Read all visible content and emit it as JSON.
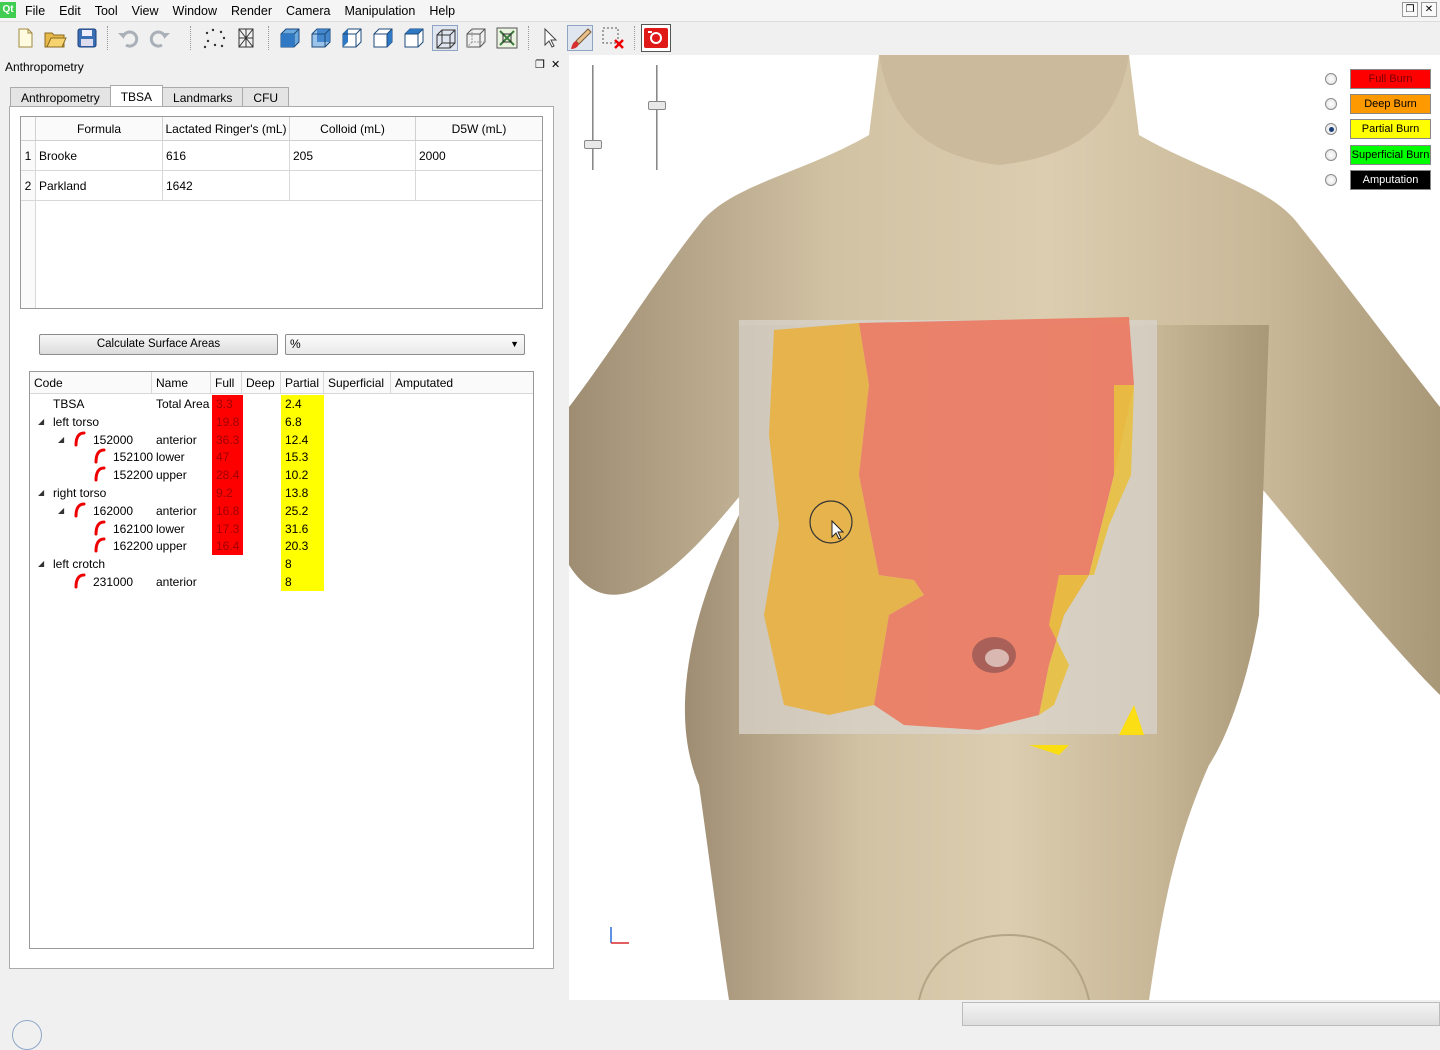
{
  "menubar": {
    "items": [
      "File",
      "Edit",
      "Tool",
      "View",
      "Window",
      "Render",
      "Camera",
      "Manipulation",
      "Help"
    ],
    "logo": "Qt"
  },
  "toolbar": {
    "icons": [
      "new-file-icon",
      "open-folder-icon",
      "save-icon",
      "undo-icon",
      "redo-icon",
      "point-cloud-icon",
      "mesh-icon",
      "cube-front-icon",
      "cube-back-icon",
      "cube-left-icon",
      "cube-right-icon",
      "cube-top-icon",
      "cube-wireframe-icon",
      "cube-transparent-icon",
      "fit-view-icon",
      "pointer-icon",
      "paint-brush-icon",
      "delete-selection-icon",
      "camera-snapshot-icon"
    ]
  },
  "dock": {
    "title": "Anthropometry",
    "tabs": [
      "Anthropometry",
      "TBSA",
      "Landmarks",
      "CFU"
    ],
    "active_tab": "TBSA"
  },
  "formula_table": {
    "headers": [
      "Formula",
      "Lactated Ringer's (mL)",
      "Colloid (mL)",
      "D5W (mL)"
    ],
    "rows": [
      {
        "n": "1",
        "formula": "Brooke",
        "lr": "616",
        "colloid": "205",
        "d5w": "2000"
      },
      {
        "n": "2",
        "formula": "Parkland",
        "lr": "1642",
        "colloid": "",
        "d5w": ""
      }
    ]
  },
  "controls": {
    "calc_button": "Calculate Surface Areas",
    "unit_value": "%"
  },
  "tree": {
    "headers": [
      "Code",
      "Name",
      "Full",
      "Deep",
      "Partial",
      "Superficial",
      "Amputated"
    ],
    "rows": [
      {
        "code": "TBSA",
        "name": "Total Area",
        "full": "3.3",
        "partial": "2.4"
      },
      {
        "code": "left torso",
        "name": "",
        "full": "19.8",
        "partial": "6.8"
      },
      {
        "code": "152000",
        "name": "anterior",
        "full": "36.3",
        "partial": "12.4"
      },
      {
        "code": "152100",
        "name": "lower",
        "full": "47",
        "partial": "15.3"
      },
      {
        "code": "152200",
        "name": "upper",
        "full": "28.4",
        "partial": "10.2"
      },
      {
        "code": "right torso",
        "name": "",
        "full": "9.2",
        "partial": "13.8"
      },
      {
        "code": "162000",
        "name": "anterior",
        "full": "16.8",
        "partial": "25.2"
      },
      {
        "code": "162100",
        "name": "lower",
        "full": "17.3",
        "partial": "31.6"
      },
      {
        "code": "162200",
        "name": "upper",
        "full": "16.4",
        "partial": "20.3"
      },
      {
        "code": "left crotch",
        "name": "",
        "full": "",
        "partial": "8"
      },
      {
        "code": "231000",
        "name": "anterior",
        "full": "",
        "partial": "8"
      }
    ]
  },
  "legend": {
    "items": [
      {
        "label": "Full Burn",
        "color": "#ff0000",
        "text_color": "#7a0000",
        "checked": false
      },
      {
        "label": "Deep Burn",
        "color": "#ff9900",
        "text_color": "#000000",
        "checked": false
      },
      {
        "label": "Partial Burn",
        "color": "#ffff00",
        "text_color": "#000000",
        "checked": true
      },
      {
        "label": "Superficial Burn",
        "color": "#00ff00",
        "text_color": "#000000",
        "checked": false
      },
      {
        "label": "Amputation",
        "color": "#000000",
        "text_color": "#ffffff",
        "checked": false
      }
    ]
  },
  "colors": {
    "full": "#ff0000",
    "partial": "#ffff00",
    "skin": "#cbb99a"
  }
}
